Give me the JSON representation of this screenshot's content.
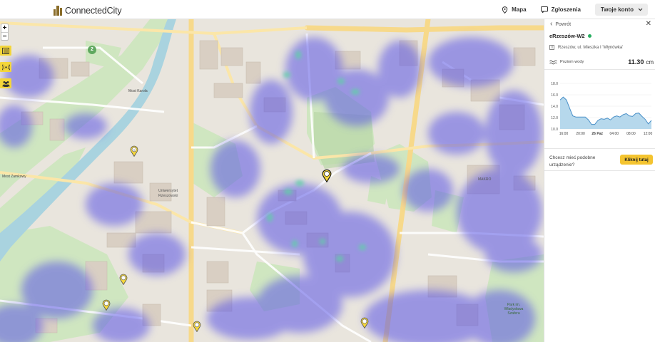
{
  "header": {
    "brand_prefix": "",
    "brand_name": "ConnectedCity",
    "nav_map": "Mapa",
    "nav_reports": "Zgłoszenia",
    "account": "Twoje konto"
  },
  "map": {
    "zoom_in": "+",
    "zoom_out": "−",
    "map_labels": {
      "most_zamkowy": "Most Zamkowy",
      "most_karola": "Most Karola",
      "uniwersytet": "Uniwersytet Rzeszowski",
      "park": "Park im. Władysława Szafera",
      "makro": "MAKRO",
      "marker_count": "2"
    },
    "tools": [
      "list-icon",
      "signal-icon",
      "people-icon"
    ]
  },
  "panel": {
    "back": "Powrót",
    "device_name": "eRzeszów-W2",
    "status_color": "#27ae60",
    "address": "Rzeszów, ul. Mieszka I 'Młynówka'",
    "level_label": "Poziom wody",
    "level_value": "11.30",
    "level_unit": "cm",
    "question": "Chcesz mieć podobne urządzenie?",
    "cta": "Kliknij tutaj"
  },
  "chart_data": {
    "type": "area",
    "title": "",
    "xlabel": "",
    "ylabel": "",
    "x_ticks": [
      "16:00",
      "20:00",
      "26 Paź",
      "04:00",
      "08:00",
      "12:00"
    ],
    "y_ticks": [
      10.0,
      12.0,
      14.0,
      16.0,
      18.0
    ],
    "ylim": [
      10.0,
      18.0
    ],
    "series": [
      {
        "name": "",
        "color": "#4a90c8",
        "fill": "#aed4ea",
        "values": [
          15.1,
          15.6,
          15.1,
          13.7,
          12.3,
          12.1,
          12.1,
          12.1,
          12.1,
          11.6,
          10.8,
          10.8,
          11.5,
          11.8,
          11.7,
          11.9,
          11.6,
          12.1,
          12.3,
          12.1,
          12.5,
          12.7,
          12.3,
          12.2,
          12.7,
          12.8,
          12.2,
          11.7,
          10.9,
          11.5
        ]
      }
    ],
    "grid": true
  }
}
